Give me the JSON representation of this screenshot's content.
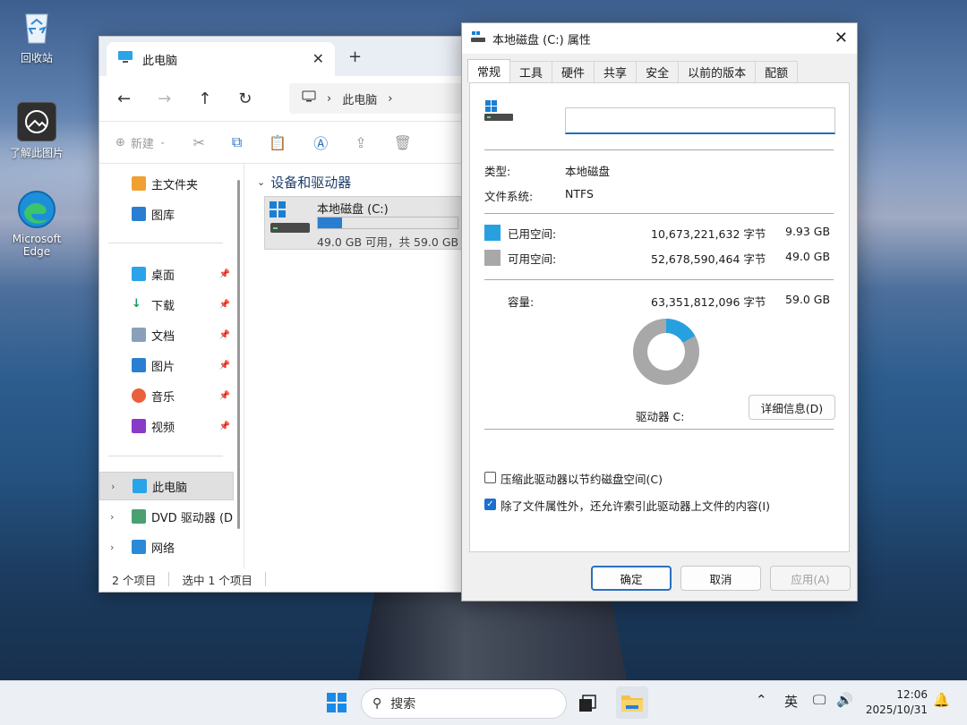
{
  "desktop": {
    "icons": [
      {
        "label": "回收站"
      },
      {
        "label": "了解此图片"
      },
      {
        "label": "Microsoft Edge"
      }
    ]
  },
  "explorer": {
    "tab_title": "此电脑",
    "address": "此电脑",
    "cmd_new": "新建",
    "sidebar": {
      "top": [
        {
          "label": "主文件夹"
        },
        {
          "label": "图库"
        }
      ],
      "pinned": [
        {
          "label": "桌面"
        },
        {
          "label": "下载"
        },
        {
          "label": "文档"
        },
        {
          "label": "图片"
        },
        {
          "label": "音乐"
        },
        {
          "label": "视频"
        }
      ],
      "tree": [
        {
          "label": "此电脑"
        },
        {
          "label": "DVD 驱动器 (D"
        },
        {
          "label": "网络"
        }
      ]
    },
    "group_title": "设备和驱动器",
    "drive": {
      "name": "本地磁盘 (C:)",
      "free_text": "49.0 GB 可用，共 59.0 GB",
      "used_fraction": 0.17
    },
    "status": {
      "items": "2 个项目",
      "selected": "选中 1 个项目"
    }
  },
  "dialog": {
    "title": "本地磁盘 (C:) 属性",
    "tabs": [
      "常规",
      "工具",
      "硬件",
      "共享",
      "安全",
      "以前的版本",
      "配额"
    ],
    "name_value": "",
    "type_label": "类型:",
    "type_value": "本地磁盘",
    "fs_label": "文件系统:",
    "fs_value": "NTFS",
    "used_label": "已用空间:",
    "used_bytes": "10,673,221,632 字节",
    "used_gb": "9.93 GB",
    "free_label": "可用空间:",
    "free_bytes": "52,678,590,464 字节",
    "free_gb": "49.0 GB",
    "cap_label": "容量:",
    "cap_bytes": "63,351,812,096 字节",
    "cap_gb": "59.0 GB",
    "drive_label": "驱动器 C:",
    "details_btn": "详细信息(D)",
    "compress_label": "压缩此驱动器以节约磁盘空间(C)",
    "index_label": "除了文件属性外，还允许索引此驱动器上文件的内容(I)",
    "ok": "确定",
    "cancel": "取消",
    "apply": "应用(A)",
    "used_fraction": 0.17,
    "colors": {
      "used": "#27a0e0",
      "free": "#a8a8a8"
    }
  },
  "taskbar": {
    "search": "搜索",
    "ime": "英",
    "time": "12:06",
    "date": "2025/10/31"
  }
}
